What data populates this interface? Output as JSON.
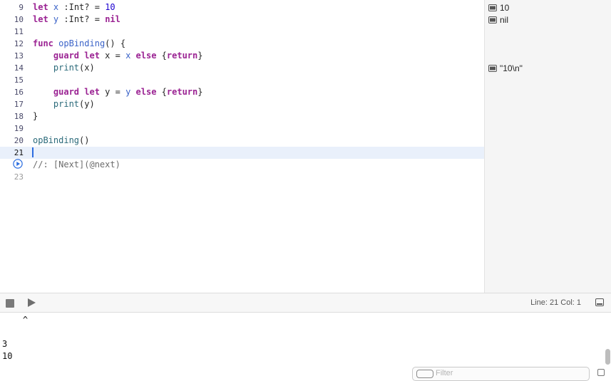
{
  "editor": {
    "lines": [
      {
        "n": "9",
        "code": [
          {
            "t": "let",
            "c": "kw"
          },
          {
            "t": " "
          },
          {
            "t": "x",
            "c": "var"
          },
          {
            "t": " :Int? = "
          },
          {
            "t": "10",
            "c": "num"
          }
        ]
      },
      {
        "n": "10",
        "code": [
          {
            "t": "let",
            "c": "kw"
          },
          {
            "t": " "
          },
          {
            "t": "y",
            "c": "var"
          },
          {
            "t": " :Int? = "
          },
          {
            "t": "nil",
            "c": "kw"
          }
        ]
      },
      {
        "n": "11",
        "code": []
      },
      {
        "n": "12",
        "code": [
          {
            "t": "func",
            "c": "kw"
          },
          {
            "t": " "
          },
          {
            "t": "opBinding",
            "c": "var"
          },
          {
            "t": "() {"
          }
        ]
      },
      {
        "n": "13",
        "code": [
          {
            "t": "    "
          },
          {
            "t": "guard",
            "c": "kw"
          },
          {
            "t": " "
          },
          {
            "t": "let",
            "c": "kw"
          },
          {
            "t": " x = "
          },
          {
            "t": "x",
            "c": "var"
          },
          {
            "t": " "
          },
          {
            "t": "else",
            "c": "kw"
          },
          {
            "t": " {"
          },
          {
            "t": "return",
            "c": "kw"
          },
          {
            "t": "}"
          }
        ]
      },
      {
        "n": "14",
        "code": [
          {
            "t": "    "
          },
          {
            "t": "print",
            "c": "fn"
          },
          {
            "t": "(x)"
          }
        ]
      },
      {
        "n": "15",
        "code": []
      },
      {
        "n": "16",
        "code": [
          {
            "t": "    "
          },
          {
            "t": "guard",
            "c": "kw"
          },
          {
            "t": " "
          },
          {
            "t": "let",
            "c": "kw"
          },
          {
            "t": " y = "
          },
          {
            "t": "y",
            "c": "var"
          },
          {
            "t": " "
          },
          {
            "t": "else",
            "c": "kw"
          },
          {
            "t": " {"
          },
          {
            "t": "return",
            "c": "kw"
          },
          {
            "t": "}"
          }
        ]
      },
      {
        "n": "17",
        "code": [
          {
            "t": "    "
          },
          {
            "t": "print",
            "c": "fn"
          },
          {
            "t": "(y)"
          }
        ]
      },
      {
        "n": "18",
        "code": [
          {
            "t": "}"
          }
        ]
      },
      {
        "n": "19",
        "code": []
      },
      {
        "n": "20",
        "code": [
          {
            "t": "opBinding",
            "c": "fn"
          },
          {
            "t": "()"
          }
        ]
      },
      {
        "n": "21",
        "code": [],
        "current": true
      },
      {
        "n": "",
        "code": [
          {
            "t": "//: [Next](@next)",
            "c": "cm"
          }
        ],
        "run": true
      },
      {
        "n": "23",
        "code": [],
        "dim": true
      }
    ]
  },
  "results": [
    {
      "line_index": 0,
      "text": "10"
    },
    {
      "line_index": 1,
      "text": "nil"
    },
    {
      "line_index": 5,
      "text": "\"10\\n\""
    }
  ],
  "statusbar": {
    "line_col": "Line: 21  Col: 1"
  },
  "console": {
    "lines": [
      "    ^",
      "",
      "",
      "3",
      "10"
    ]
  },
  "filter": {
    "placeholder": "Filter"
  },
  "icons": {
    "run": "play-circle-icon",
    "result": "quicklook-icon",
    "stop": "stop-icon",
    "execute": "play-icon",
    "panel": "panel-toggle-icon",
    "filter": "filter-icon",
    "trash": "trash-icon"
  }
}
